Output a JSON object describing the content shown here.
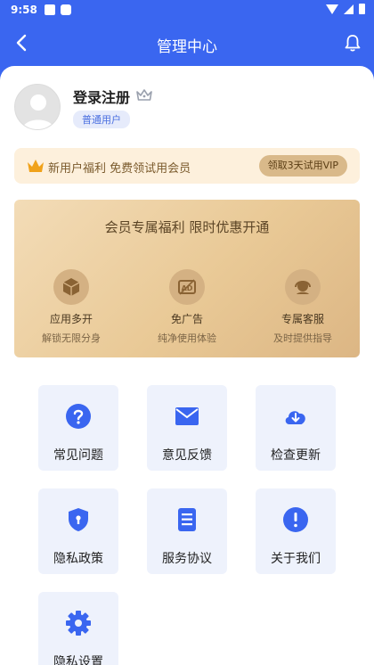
{
  "status": {
    "time": "9:58"
  },
  "appbar": {
    "title": "管理中心",
    "back_icon": "back-arrow-icon",
    "bell_icon": "bell-icon"
  },
  "profile": {
    "name": "登录注册",
    "badge": "普通用户"
  },
  "promo": {
    "text": "新用户福利 免费领试用会员",
    "button": "领取3天试用VIP"
  },
  "vip": {
    "title": "会员专属福利 限时优惠开通",
    "benefits": [
      {
        "name": "应用多开",
        "sub": "解锁无限分身",
        "icon": "box-icon"
      },
      {
        "name": "免广告",
        "sub": "纯净使用体验",
        "icon": "ad-free-icon"
      },
      {
        "name": "专属客服",
        "sub": "及时提供指导",
        "icon": "support-icon"
      }
    ]
  },
  "tiles": [
    {
      "label": "常见问题",
      "icon": "question-icon"
    },
    {
      "label": "意见反馈",
      "icon": "mail-icon"
    },
    {
      "label": "检查更新",
      "icon": "cloud-download-icon"
    },
    {
      "label": "隐私政策",
      "icon": "shield-icon"
    },
    {
      "label": "服务协议",
      "icon": "document-icon"
    },
    {
      "label": "关于我们",
      "icon": "info-icon"
    },
    {
      "label": "隐私设置",
      "icon": "gear-icon"
    }
  ],
  "colors": {
    "primary": "#3a66f0",
    "gold": "#e9c996",
    "tile_bg": "#eef2fc"
  }
}
